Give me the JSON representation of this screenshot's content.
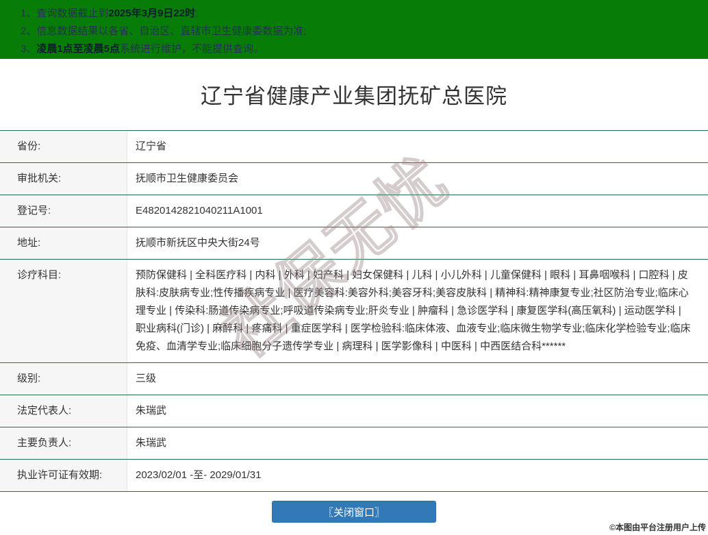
{
  "colors": {
    "header_green": "#077d07",
    "table_border_green": "#256d43",
    "label_background": "#f6f6f6",
    "button_blue": "#3279b7"
  },
  "notices": [
    {
      "num": "1、",
      "pre": "查询数据截止到",
      "bold": "2025年3月9日22时",
      "post": ";"
    },
    {
      "num": "2、",
      "pre": "信息数据结果以各省、自治区、直辖市卫生健康委数据为准;",
      "bold": "",
      "post": ""
    },
    {
      "num": "3、",
      "pre": "",
      "bold": "凌晨1点至凌晨5点",
      "post": "系统进行维护，不能提供查询。"
    }
  ],
  "title": "辽宁省健康产业集团抚矿总医院",
  "table": {
    "rows": [
      {
        "label": "省份:",
        "value": "辽宁省"
      },
      {
        "label": "审批机关:",
        "value": "抚顺市卫生健康委员会"
      },
      {
        "label": "登记号:",
        "value": "E4820142821040211A1001"
      },
      {
        "label": "地址:",
        "value": "抚顺市新抚区中央大街24号"
      },
      {
        "label": "诊疗科目:",
        "value": "预防保健科 | 全科医疗科 | 内科 | 外科 | 妇产科 | 妇女保健科 | 儿科 | 小儿外科 | 儿童保健科 | 眼科 | 耳鼻咽喉科 | 口腔科 | 皮肤科:皮肤病专业;性传播疾病专业 | 医疗美容科:美容外科;美容牙科;美容皮肤科 | 精神科:精神康复专业;社区防治专业;临床心理专业 | 传染科:肠道传染病专业;呼吸道传染病专业;肝炎专业 | 肿瘤科 | 急诊医学科 | 康复医学科(高压氧科) | 运动医学科 | 职业病科(门诊) | 麻醉科 | 疼痛科 | 重症医学科 | 医学检验科:临床体液、血液专业;临床微生物学专业;临床化学检验专业;临床免疫、血清学专业;临床细胞分子遗传学专业 | 病理科 | 医学影像科 | 中医科 | 中西医结合科******"
      },
      {
        "label": "级别:",
        "value": "三级"
      },
      {
        "label": "法定代表人:",
        "value": "朱瑞武"
      },
      {
        "label": "主要负责人:",
        "value": "朱瑞武"
      },
      {
        "label": "执业许可证有效期:",
        "value": "2023/02/01 -至- 2029/01/31"
      }
    ]
  },
  "close_button_label": "〖关闭窗口〗",
  "watermark": "社保无忧",
  "image_credit": "©本图由平台注册用户上传"
}
